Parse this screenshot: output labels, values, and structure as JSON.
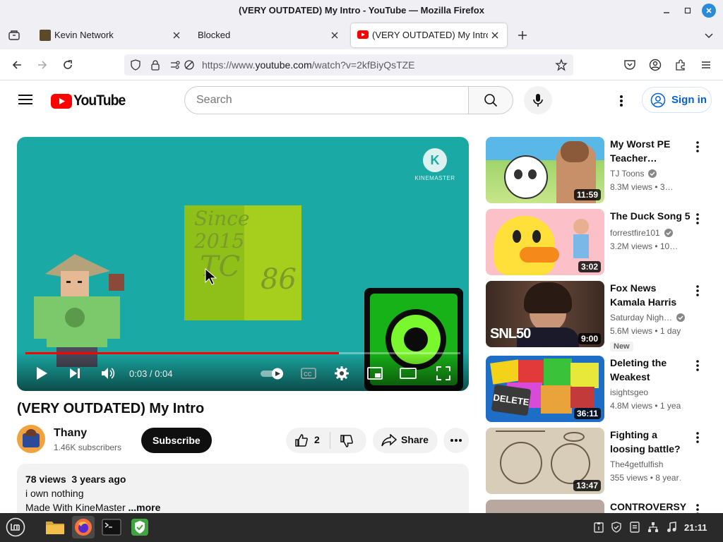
{
  "window": {
    "title": "(VERY OUTDATED) My Intro - YouTube — Mozilla Firefox"
  },
  "tabs": [
    {
      "label": "Kevin Network",
      "active": false
    },
    {
      "label": "Blocked",
      "active": false
    },
    {
      "label": "(VERY OUTDATED) My Intro",
      "active": true
    }
  ],
  "url": {
    "prefix": "https://www.",
    "domain": "youtube.com",
    "path": "/watch?v=2kfBiyQsTZE"
  },
  "youtube": {
    "logo_text": "YouTube",
    "search_placeholder": "Search",
    "signin_label": "Sign in"
  },
  "player": {
    "time": "0:03 / 0:04",
    "progress_fraction": 0.72,
    "watermark": "KINEMASTER",
    "logo_letter": "K",
    "overlay_text": [
      "Since",
      "2015",
      "TC",
      "86"
    ]
  },
  "video": {
    "title": "(VERY OUTDATED) My Intro",
    "channel": "Thany",
    "subscribers": "1.46K subscribers",
    "subscribe_label": "Subscribe",
    "likes": "2",
    "share_label": "Share"
  },
  "description": {
    "views": "78 views",
    "age": "3 years ago",
    "line1": "i own nothing",
    "line2": "Made With KineMaster",
    "more": "...more"
  },
  "recommendations": [
    {
      "title": "My Worst PE Teacher…",
      "channel": "TJ Toons",
      "verified": true,
      "meta": "8.3M views • 3…",
      "duration": "11:59",
      "badge": ""
    },
    {
      "title": "The Duck Song 5",
      "channel": "forrestfire101",
      "verified": true,
      "meta": "3.2M views • 10…",
      "duration": "3:02",
      "badge": ""
    },
    {
      "title": "Fox News Kamala Harris Interview…",
      "channel": "Saturday Nigh…",
      "verified": true,
      "meta": "5.6M views • 1 day…",
      "duration": "9:00",
      "badge": "New",
      "thumb_text": "SNL50"
    },
    {
      "title": "Deleting the Weakest STATE…",
      "channel": "isightsgeo",
      "verified": false,
      "meta": "4.8M views • 1 yea…",
      "duration": "36:11",
      "badge": "",
      "thumb_text": "DELETE"
    },
    {
      "title": "Fighting a loosing battle?",
      "channel": "The4getfulfish",
      "verified": false,
      "meta": "355 views • 8 year…",
      "duration": "13:47",
      "badge": ""
    },
    {
      "title": "CONTROVERSY",
      "channel": "",
      "verified": false,
      "meta": "",
      "duration": "",
      "badge": ""
    }
  ],
  "taskbar": {
    "clock": "21:11"
  },
  "colors": {
    "youtube_red": "#ff0000",
    "progress_red": "#ff0000",
    "player_bg": "#1aa9a4",
    "taskbar_bg": "#2a2a2a"
  }
}
